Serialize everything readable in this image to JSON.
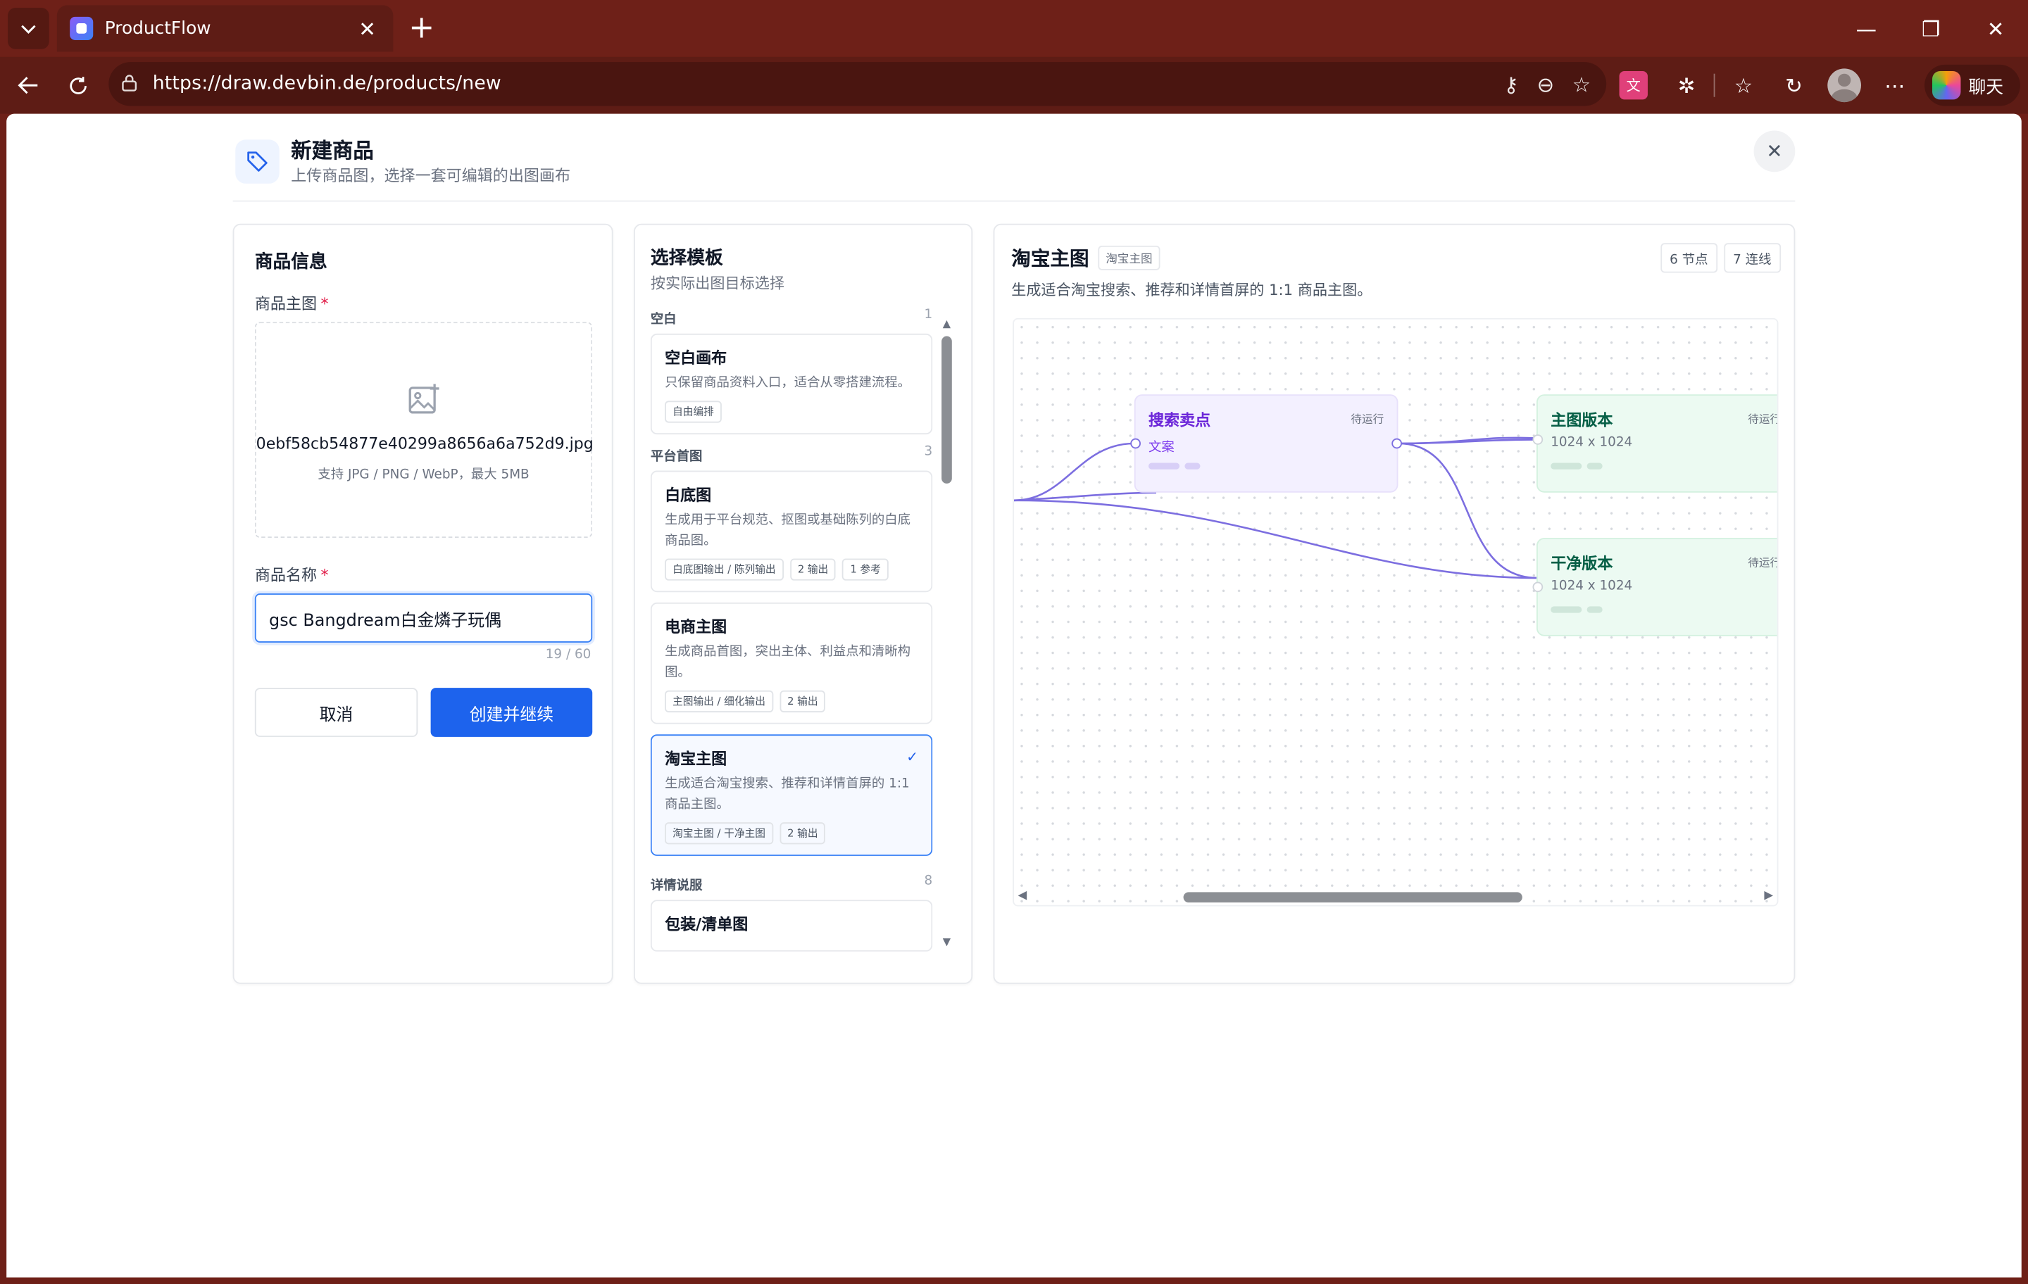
{
  "browser": {
    "tab_title": "ProductFlow",
    "url": "https://draw.devbin.de/products/new",
    "copilot_label": "聊天"
  },
  "header": {
    "title": "新建商品",
    "subtitle": "上传商品图，选择一套可编辑的出图画布"
  },
  "product_form": {
    "section_title": "商品信息",
    "image_label": "商品主图",
    "required_mark": "*",
    "file_name": "0ebf58cb54877e40299a8656a6a752d9.jpg",
    "upload_hint": "支持 JPG / PNG / WebP，最大 5MB",
    "name_label": "商品名称",
    "name_value": "gsc Bangdream白金燐子玩偶",
    "name_counter": "19 / 60",
    "cancel_label": "取消",
    "create_label": "创建并继续"
  },
  "templates": {
    "title": "选择模板",
    "subtitle": "按实际出图目标选择",
    "groups": [
      {
        "name": "空白",
        "count": "1",
        "items": [
          {
            "name": "空白画布",
            "desc": "只保留商品资料入口，适合从零搭建流程。",
            "chips": [
              "自由编排"
            ]
          }
        ]
      },
      {
        "name": "平台首图",
        "count": "3",
        "items": [
          {
            "name": "白底图",
            "desc": "生成用于平台规范、抠图或基础陈列的白底商品图。",
            "chips": [
              "白底图输出 / 陈列输出",
              "2 输出",
              "1 参考"
            ]
          },
          {
            "name": "电商主图",
            "desc": "生成商品首图，突出主体、利益点和清晰构图。",
            "chips": [
              "主图输出 / 细化输出",
              "2 输出"
            ]
          },
          {
            "name": "淘宝主图",
            "desc": "生成适合淘宝搜索、推荐和详情首屏的 1:1 商品主图。",
            "chips": [
              "淘宝主图 / 干净主图",
              "2 输出"
            ]
          }
        ]
      },
      {
        "name": "详情说服",
        "count": "8",
        "items": [
          {
            "name": "包装/清单图"
          }
        ]
      }
    ]
  },
  "preview": {
    "title": "淘宝主图",
    "badge": "淘宝主图",
    "nodes_count": "6 节点",
    "edges_count": "7 连线",
    "description": "生成适合淘宝搜索、推荐和详情首屏的 1:1 商品主图。",
    "nodes": [
      {
        "name": "搜索卖点",
        "type": "文案",
        "status": "待运行"
      },
      {
        "name": "主图版本",
        "size": "1024 x 1024",
        "status": "待运行"
      },
      {
        "name": "干净版本",
        "size": "1024 x 1024",
        "status": "待运行"
      }
    ]
  }
}
